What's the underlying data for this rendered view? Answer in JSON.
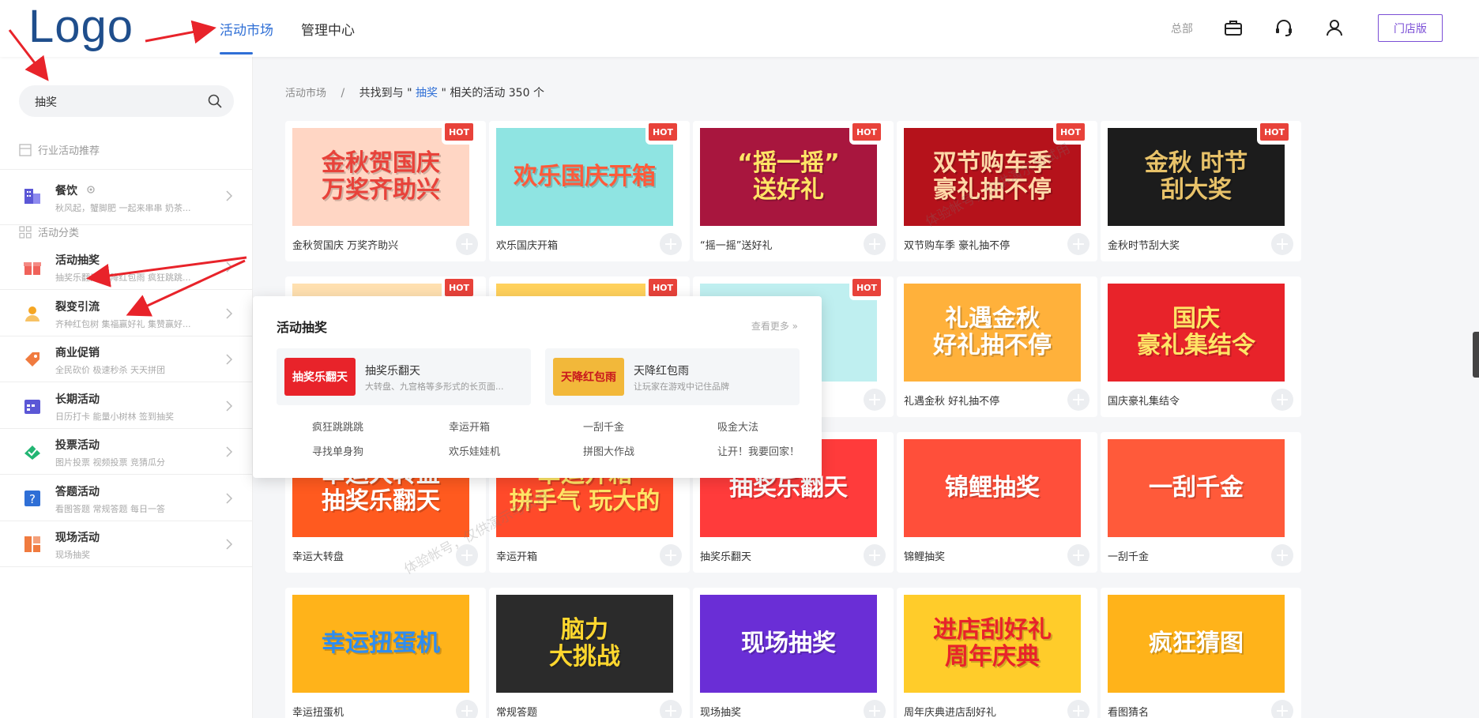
{
  "header": {
    "logo": "Logo",
    "nav": [
      "活动市场",
      "管理中心"
    ],
    "org": "总部",
    "store_button": "门店版"
  },
  "sidebar": {
    "search_value": "抽奖",
    "industry_title": "行业活动推荐",
    "industry": {
      "title": "餐饮",
      "desc": "秋风起，蟹脚肥  一起来串串  奶茶..."
    },
    "category_title": "活动分类",
    "items": [
      {
        "title": "活动抽奖",
        "desc": "抽奖乐翻天  天降红包雨  疯狂跳跳...",
        "icon": "gift-icon"
      },
      {
        "title": "裂变引流",
        "desc": "齐种红包树  集福赢好礼  集赞赢好...",
        "icon": "user-group-icon"
      },
      {
        "title": "商业促销",
        "desc": "全民砍价  极速秒杀  天天拼团",
        "icon": "tag-icon"
      },
      {
        "title": "长期活动",
        "desc": "日历打卡  能量小树林  签到抽奖",
        "icon": "calendar-icon"
      },
      {
        "title": "投票活动",
        "desc": "图片投票  视频投票  竞猜瓜分",
        "icon": "vote-icon"
      },
      {
        "title": "答题活动",
        "desc": "看图答题  常规答题  每日一答",
        "icon": "question-icon"
      },
      {
        "title": "现场活动",
        "desc": "现场抽奖",
        "icon": "layout-icon"
      }
    ]
  },
  "breadcrumb": {
    "root": "活动市场",
    "prefix": "共找到与 \"",
    "keyword": "抽奖",
    "suffix": "\" 相关的活动 350 个"
  },
  "cards": [
    {
      "caption": "金秋贺国庆 万奖齐助兴",
      "art": "金秋贺国庆\n万奖齐助兴",
      "bg": "#ffd6c4",
      "fg": "#e8423a",
      "hot": true
    },
    {
      "caption": "欢乐国庆开箱",
      "art": "欢乐国庆开箱",
      "bg": "#8fe4e2",
      "fg": "#ff5a3a",
      "hot": true
    },
    {
      "caption": "“摇一摇”送好礼",
      "art": "“摇一摇”\n送好礼",
      "bg": "#a8163e",
      "fg": "#ffe566",
      "hot": true
    },
    {
      "caption": "双节购车季 豪礼抽不停",
      "art": "双节购车季\n豪礼抽不停",
      "bg": "#b5121b",
      "fg": "#ffd9a8",
      "hot": true
    },
    {
      "caption": "金秋时节刮大奖",
      "art": "金秋 时节\n刮大奖",
      "bg": "#1c1c1c",
      "fg": "#e8c269",
      "hot": true
    },
    {
      "caption": "",
      "art": "",
      "bg": "#ffe0b0",
      "fg": "#fff",
      "hot": true
    },
    {
      "caption": "",
      "art": "",
      "bg": "#ffd15c",
      "fg": "#fff",
      "hot": true
    },
    {
      "caption": "",
      "art": "",
      "bg": "#bfeff0",
      "fg": "#fff",
      "hot": true
    },
    {
      "caption": "礼遇金秋 好礼抽不停",
      "art": "礼遇金秋\n好礼抽不停",
      "bg": "#ffb13b",
      "fg": "#fff",
      "hot": false
    },
    {
      "caption": "国庆豪礼集结令",
      "art": "国庆\n豪礼集结令",
      "bg": "#e8232a",
      "fg": "#ffe566",
      "hot": false
    },
    {
      "caption": "幸运大转盘",
      "art": "幸运大转盘\n抽奖乐翻天",
      "bg": "#ff5a1f",
      "fg": "#fff",
      "hot": false
    },
    {
      "caption": "幸运开箱",
      "art": "幸运开箱\n拼手气 玩大的",
      "bg": "#ff4a2a",
      "fg": "#ffe566",
      "hot": false
    },
    {
      "caption": "抽奖乐翻天",
      "art": "抽奖乐翻天",
      "bg": "#ff3b3b",
      "fg": "#fff",
      "hot": false
    },
    {
      "caption": "锦鲤抽奖",
      "art": "锦鲤抽奖",
      "bg": "#ff4f3a",
      "fg": "#fff",
      "hot": false
    },
    {
      "caption": "一刮千金",
      "art": "一刮千金",
      "bg": "#ff5a3a",
      "fg": "#fff",
      "hot": false
    },
    {
      "caption": "幸运扭蛋机",
      "art": "幸运扭蛋机",
      "bg": "#ffb31a",
      "fg": "#2f8df0",
      "hot": false
    },
    {
      "caption": "常规答题",
      "art": "脑力\n大挑战",
      "bg": "#2b2b2b",
      "fg": "#ffd72e",
      "hot": false
    },
    {
      "caption": "现场抽奖",
      "art": "现场抽奖",
      "bg": "#6a2ed6",
      "fg": "#fff",
      "hot": false
    },
    {
      "caption": "周年庆典进店刮好礼",
      "art": "进店刮好礼\n周年庆典",
      "bg": "#ffcc2a",
      "fg": "#e8232a",
      "hot": false
    },
    {
      "caption": "看图猜名",
      "art": "疯狂猜图",
      "bg": "#ffb31a",
      "fg": "#fff",
      "hot": false
    }
  ],
  "popup": {
    "title": "活动抽奖",
    "more": "查看更多 »",
    "featured": [
      {
        "title": "抽奖乐翻天",
        "desc": "大转盘、九宫格等多形式的长页面...",
        "art": "抽奖乐翻天",
        "bg": "#e8232a"
      },
      {
        "title": "天降红包雨",
        "desc": "让玩家在游戏中记住品牌",
        "art": "天降红包雨",
        "bg": "#f2b83a"
      }
    ],
    "links": [
      "疯狂跳跳跳",
      "幸运开箱",
      "一刮千金",
      "吸金大法",
      "寻找单身狗",
      "欢乐娃娃机",
      "拼图大作战",
      "让开！我要回家！"
    ]
  },
  "watermark": "体验帐号，仅供演示与试用",
  "colors": {
    "accent": "#2f6fd6",
    "hot": "#e8423a",
    "purple": "#7b4fd6",
    "arrow": "#e8232a"
  }
}
